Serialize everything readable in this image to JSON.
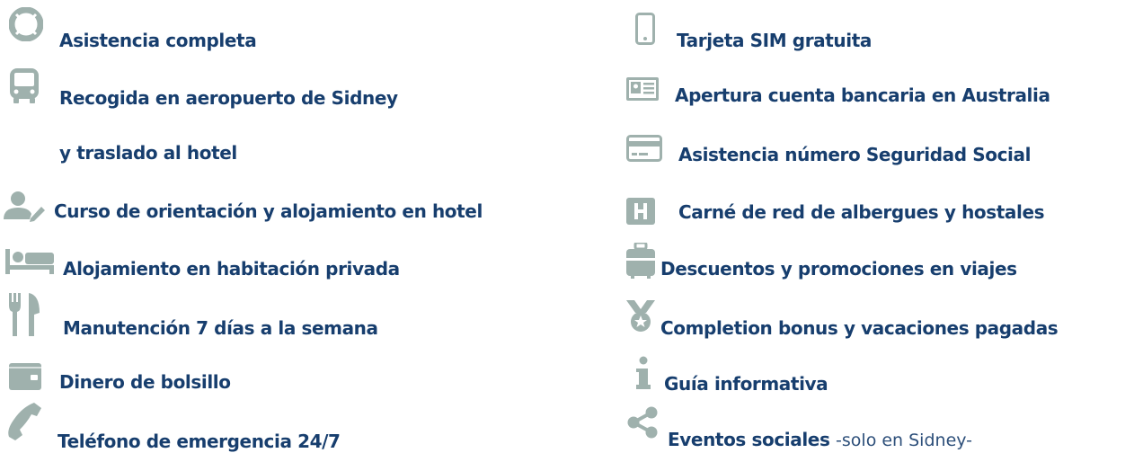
{
  "theme": {
    "text_color": "#173e6e",
    "icon_color": "#9fb1ad"
  },
  "left_features": [
    {
      "icon": "lifebuoy-icon",
      "label": "Asistencia completa"
    },
    {
      "icon": "bus-icon",
      "label": "Recogida en aeropuerto de Sidney"
    },
    {
      "icon": "",
      "label": "y traslado al hotel"
    },
    {
      "icon": "user-edit-icon",
      "label": "Curso de orientación y alojamiento en hotel"
    },
    {
      "icon": "bed-icon",
      "label": "Alojamiento en habitación privada"
    },
    {
      "icon": "utensils-icon",
      "label": "Manutención 7 días a la semana"
    },
    {
      "icon": "wallet-icon",
      "label": "Dinero de bolsillo"
    },
    {
      "icon": "phone-icon",
      "label": "Teléfono de emergencia 24/7"
    }
  ],
  "right_features": [
    {
      "icon": "mobile-phone-icon",
      "label": "Tarjeta SIM gratuita"
    },
    {
      "icon": "id-card-icon",
      "label": "Apertura cuenta bancaria en Australia"
    },
    {
      "icon": "credit-card-icon",
      "label": "Asistencia número Seguridad Social"
    },
    {
      "icon": "hostel-h-icon",
      "label": "Carné de red de albergues y hostales"
    },
    {
      "icon": "suitcase-icon",
      "label": "Descuentos y promociones en viajes"
    },
    {
      "icon": "medal-icon",
      "label": "Completion bonus y vacaciones pagadas"
    },
    {
      "icon": "info-icon",
      "label": "Guía informativa"
    },
    {
      "icon": "share-icon",
      "label": "Eventos sociales",
      "note": "-solo en Sidney-"
    }
  ]
}
